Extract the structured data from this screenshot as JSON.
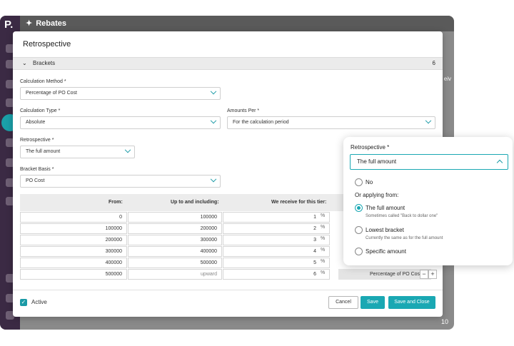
{
  "app": {
    "logo": "P.",
    "window_title": "Rebates",
    "side_fragment": "eiv",
    "bottom_number": "10"
  },
  "modal": {
    "title": "Retrospective",
    "section": {
      "label": "Brackets",
      "count": "6"
    },
    "calc_method": {
      "label": "Calculation Method *",
      "value": "Percentage of PO Cost"
    },
    "calc_type": {
      "label": "Calculation Type *",
      "value": "Absolute"
    },
    "amounts_per": {
      "label": "Amounts Per *",
      "value": "For the calculation period"
    },
    "retrospective": {
      "label": "Retrospective *",
      "value": "The full amount"
    },
    "bracket_basis": {
      "label": "Bracket Basis *",
      "value": "PO Cost"
    },
    "table": {
      "headers": {
        "from": "From:",
        "upto": "Up to and including:",
        "receive": "We receive for this tier:"
      },
      "unit": "%",
      "rows": [
        {
          "from": "0",
          "upto": "100000",
          "receive": "1"
        },
        {
          "from": "100000",
          "upto": "200000",
          "receive": "2"
        },
        {
          "from": "200000",
          "upto": "300000",
          "receive": "3"
        },
        {
          "from": "300000",
          "upto": "400000",
          "receive": "4"
        },
        {
          "from": "400000",
          "upto": "500000",
          "receive": "5"
        },
        {
          "from": "500000",
          "upto": "upward",
          "receive": "6"
        }
      ],
      "last_row_basis": "Percentage of PO Cost",
      "minus": "−",
      "plus": "+"
    },
    "footer": {
      "active_label": "Active",
      "cancel": "Cancel",
      "save": "Save",
      "save_close": "Save and Close"
    }
  },
  "popover": {
    "label": "Retrospective *",
    "value": "The full amount",
    "options": {
      "no": "No",
      "group": "Or applying from:",
      "full": {
        "name": "The full amount",
        "sub": "Sometimes called \"Back to dollar one\""
      },
      "lowest": {
        "name": "Lowest bracket",
        "sub": "Currently the same as for the full amount"
      },
      "specific": {
        "name": "Specific amount"
      }
    }
  },
  "colors": {
    "accent": "#1aa8b3",
    "rail": "#3b2a44"
  },
  "icons": [
    "star-icon",
    "chevron-down-icon",
    "chevron-up-icon",
    "check-icon",
    "minus-icon",
    "plus-icon"
  ]
}
